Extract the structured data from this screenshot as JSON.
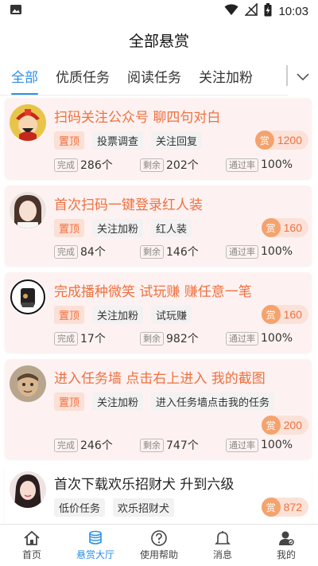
{
  "status": {
    "time": "10:03"
  },
  "header": {
    "title": "全部悬赏"
  },
  "tabs": [
    {
      "label": "全部"
    },
    {
      "label": "优质任务"
    },
    {
      "label": "阅读任务"
    },
    {
      "label": "关注加粉"
    }
  ],
  "labels": {
    "done": "完成",
    "remain": "剩余",
    "rate": "通过率",
    "reward_mark": "赏"
  },
  "tasks": [
    {
      "title": "扫码关注公众号 聊四句对白",
      "tags": [
        "置顶",
        "投票调查",
        "关注回复"
      ],
      "reward": "1200",
      "done": "286个",
      "remain": "202个",
      "rate": "100%"
    },
    {
      "title": "首次扫码一键登录红人装",
      "tags": [
        "置顶",
        "关注加粉",
        "红人装"
      ],
      "reward": "160",
      "done": "84个",
      "remain": "146个",
      "rate": "100%"
    },
    {
      "title": "完成播种微笑 试玩赚 赚任意一笔",
      "tags": [
        "置顶",
        "关注加粉",
        "试玩赚"
      ],
      "reward": "160",
      "done": "17个",
      "remain": "982个",
      "rate": "100%"
    },
    {
      "title": "进入任务墙 点击右上进入 我的截图",
      "tags": [
        "置顶",
        "关注加粉",
        "进入任务墙点击我的任务"
      ],
      "reward": "200",
      "done": "246个",
      "remain": "747个",
      "rate": "100%"
    },
    {
      "title": "首次下载欢乐招财犬 升到六级",
      "tags": [
        "低价任务",
        "欢乐招财犬"
      ],
      "reward": "872"
    }
  ],
  "nav": [
    {
      "label": "首页",
      "icon": "home-icon"
    },
    {
      "label": "悬赏大厅",
      "icon": "coins-icon"
    },
    {
      "label": "使用帮助",
      "icon": "help-icon"
    },
    {
      "label": "消息",
      "icon": "bell-icon"
    },
    {
      "label": "我的",
      "icon": "user-icon"
    }
  ],
  "colors": {
    "accent": "#2b8fe8",
    "highlight": "#f07040",
    "card_bg": "#fdf2f1"
  }
}
